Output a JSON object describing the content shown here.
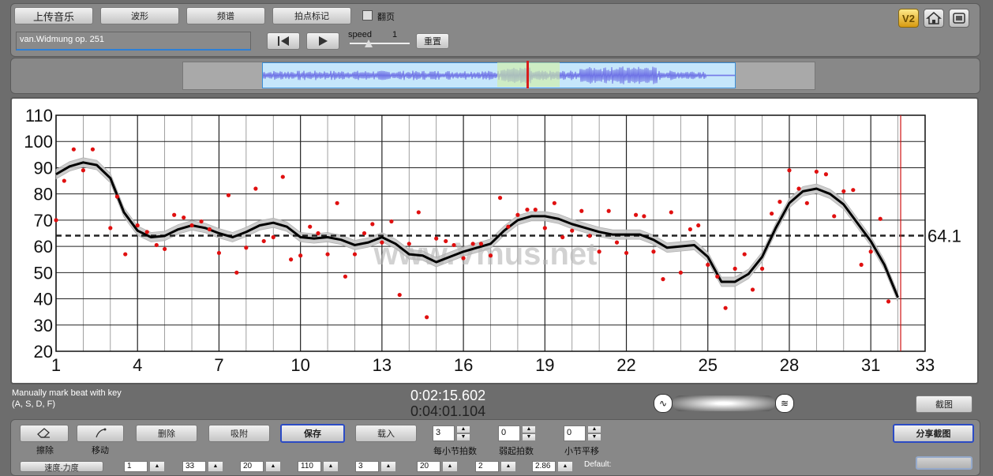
{
  "toolbar": {
    "upload_music": "上传音乐",
    "waveform": "波形",
    "spectrum": "频谱",
    "beat_mark": "拍点标记",
    "page_turn_label": "翻页",
    "page_turn_checked": false,
    "file_name": "van.Widmung op. 251",
    "speed_label": "speed",
    "speed_value": "1",
    "reset_label": "重置",
    "version_badge": "V2"
  },
  "chart_data": {
    "type": "line",
    "xlim": [
      1,
      33
    ],
    "ylim": [
      20,
      110
    ],
    "x_ticks": [
      "1",
      "4",
      "7",
      "10",
      "13",
      "16",
      "19",
      "22",
      "25",
      "28",
      "31",
      "33"
    ],
    "y_ticks": [
      "110",
      "100",
      "90",
      "80",
      "70",
      "60",
      "50",
      "40",
      "30",
      "20"
    ],
    "mean_value": 64.1,
    "mean_label": "64.1",
    "cursor_x": 32.1,
    "watermark": "www.Vmus.net",
    "grid": true,
    "smooth_curve": [
      [
        1,
        87.5
      ],
      [
        1.5,
        90.5
      ],
      [
        2,
        92
      ],
      [
        2.5,
        91
      ],
      [
        3,
        86
      ],
      [
        3.5,
        73
      ],
      [
        4,
        66
      ],
      [
        4.5,
        63.5
      ],
      [
        5,
        64
      ],
      [
        5.5,
        66.5
      ],
      [
        6,
        68
      ],
      [
        6.5,
        67
      ],
      [
        7,
        65
      ],
      [
        7.5,
        63.5
      ],
      [
        8,
        65.5
      ],
      [
        8.5,
        68
      ],
      [
        9,
        69
      ],
      [
        9.5,
        67.5
      ],
      [
        10,
        63.5
      ],
      [
        10.5,
        63
      ],
      [
        11,
        63.5
      ],
      [
        11.5,
        62.5
      ],
      [
        12,
        60.5
      ],
      [
        12.5,
        61.5
      ],
      [
        13,
        63.5
      ],
      [
        13.5,
        61
      ],
      [
        14,
        57
      ],
      [
        14.5,
        56.5
      ],
      [
        15,
        54
      ],
      [
        15.5,
        56
      ],
      [
        16,
        58
      ],
      [
        16.5,
        59.5
      ],
      [
        17,
        61
      ],
      [
        17.5,
        66
      ],
      [
        18,
        70
      ],
      [
        18.5,
        71.5
      ],
      [
        19,
        71.5
      ],
      [
        19.5,
        70.5
      ],
      [
        20,
        68.5
      ],
      [
        20.5,
        67
      ],
      [
        21,
        65.5
      ],
      [
        21.5,
        64.5
      ],
      [
        22,
        64.5
      ],
      [
        22.5,
        64.5
      ],
      [
        23,
        62.5
      ],
      [
        23.5,
        59.5
      ],
      [
        24,
        60
      ],
      [
        24.5,
        60.5
      ],
      [
        25,
        56
      ],
      [
        25.5,
        46.5
      ],
      [
        26,
        46.5
      ],
      [
        26.5,
        49.5
      ],
      [
        27,
        56
      ],
      [
        27.5,
        67
      ],
      [
        28,
        76.5
      ],
      [
        28.5,
        81
      ],
      [
        29,
        82
      ],
      [
        29.5,
        80
      ],
      [
        30,
        76
      ],
      [
        30.5,
        69
      ],
      [
        31,
        62
      ],
      [
        31.5,
        53
      ],
      [
        32,
        40.5
      ]
    ],
    "points": [
      [
        1,
        70
      ],
      [
        1.3,
        85
      ],
      [
        1.65,
        97
      ],
      [
        2,
        89
      ],
      [
        2.35,
        97
      ],
      [
        3,
        67
      ],
      [
        3.25,
        79
      ],
      [
        3.55,
        57
      ],
      [
        4,
        68
      ],
      [
        4.35,
        65.5
      ],
      [
        4.7,
        60.5
      ],
      [
        5,
        59
      ],
      [
        5.35,
        72
      ],
      [
        5.7,
        71
      ],
      [
        6,
        68
      ],
      [
        6.35,
        69.5
      ],
      [
        6.65,
        66.5
      ],
      [
        7,
        57.5
      ],
      [
        7.35,
        79.5
      ],
      [
        7.65,
        50
      ],
      [
        8,
        59.5
      ],
      [
        8.35,
        82
      ],
      [
        8.65,
        62
      ],
      [
        9,
        63.5
      ],
      [
        9.35,
        86.5
      ],
      [
        9.65,
        55
      ],
      [
        10,
        56.5
      ],
      [
        10.35,
        67.5
      ],
      [
        10.65,
        65
      ],
      [
        11,
        57
      ],
      [
        11.35,
        76.5
      ],
      [
        11.65,
        48.5
      ],
      [
        12,
        57
      ],
      [
        12.35,
        65
      ],
      [
        12.65,
        68.5
      ],
      [
        13,
        61.5
      ],
      [
        13.35,
        69.5
      ],
      [
        13.65,
        41.5
      ],
      [
        14,
        61
      ],
      [
        14.35,
        73
      ],
      [
        14.65,
        33
      ],
      [
        15,
        63
      ],
      [
        15.35,
        62
      ],
      [
        15.65,
        60.5
      ],
      [
        16,
        55.5
      ],
      [
        16.35,
        61
      ],
      [
        16.65,
        61
      ],
      [
        17,
        56.5
      ],
      [
        17.35,
        78.5
      ],
      [
        17.65,
        67.5
      ],
      [
        18,
        72
      ],
      [
        18.35,
        74
      ],
      [
        18.65,
        74
      ],
      [
        19,
        67
      ],
      [
        19.35,
        76.5
      ],
      [
        19.65,
        63.5
      ],
      [
        20,
        66
      ],
      [
        20.35,
        73.5
      ],
      [
        20.65,
        64
      ],
      [
        21,
        58
      ],
      [
        21.35,
        73.5
      ],
      [
        21.65,
        61.5
      ],
      [
        22,
        57.5
      ],
      [
        22.35,
        72
      ],
      [
        22.65,
        71.5
      ],
      [
        23,
        58
      ],
      [
        23.35,
        47.5
      ],
      [
        23.65,
        73
      ],
      [
        24,
        50
      ],
      [
        24.35,
        66.5
      ],
      [
        24.65,
        68
      ],
      [
        25,
        53
      ],
      [
        25.35,
        48.5
      ],
      [
        25.65,
        36.5
      ],
      [
        26,
        51.5
      ],
      [
        26.35,
        57
      ],
      [
        26.65,
        43.5
      ],
      [
        27,
        51.5
      ],
      [
        27.35,
        72.5
      ],
      [
        27.65,
        77
      ],
      [
        28,
        89
      ],
      [
        28.35,
        82
      ],
      [
        28.65,
        76.5
      ],
      [
        29,
        88.5
      ],
      [
        29.35,
        87.5
      ],
      [
        29.65,
        71.5
      ],
      [
        30,
        81
      ],
      [
        30.35,
        81.5
      ],
      [
        30.65,
        53
      ],
      [
        31,
        58
      ],
      [
        31.35,
        70.5
      ],
      [
        31.65,
        39
      ]
    ]
  },
  "status": {
    "hint_line1": "Manually mark beat with key",
    "hint_line2": "(A, S, D, F)",
    "time_current": "0:02:15.602",
    "time_total": "0:04:01.104",
    "screenshot_label": "截图"
  },
  "bottom": {
    "erase_label": "擦除",
    "move_label": "移动",
    "delete_label": "删除",
    "attach_label": "吸附",
    "save_label": "保存",
    "load_label": "载入",
    "beats_per_bar_value": "3",
    "beats_per_bar_label": "每小节拍数",
    "pickup_value": "0",
    "pickup_label": "弱起拍数",
    "bar_shift_value": "0",
    "bar_shift_label": "小节平移",
    "share_label": "分享截图",
    "cut_button_label": "速度·力度",
    "default_label": "Default:",
    "bottom_values": [
      "1",
      "33",
      "20",
      "110",
      "3",
      "20",
      "2",
      "2.86"
    ]
  }
}
